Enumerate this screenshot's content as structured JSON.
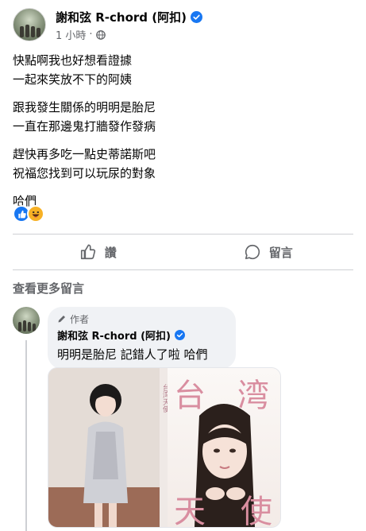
{
  "post": {
    "author": "謝和弦 R-chord (阿扣)",
    "time": "1 小時",
    "dot": "·",
    "paragraphs": [
      [
        "快點啊我也好想看證據",
        "一起來笑放不下的阿姨"
      ],
      [
        "跟我發生關係的明明是胎尼",
        "一直在那邊鬼打牆發作發病"
      ],
      [
        "趕快再多吃一點史蒂諾斯吧",
        "祝福您找到可以玩尿的對象"
      ],
      [
        "哈們"
      ]
    ]
  },
  "actions": {
    "like_label": "讚",
    "comment_label": "留言"
  },
  "comments_section": {
    "more_label": "查看更多留言"
  },
  "comment": {
    "author_tag": "作者",
    "author": "謝和弦 R-chord (阿扣)",
    "text": "明明是胎尼 記錯人了啦 哈們",
    "image_text": {
      "top_right_1": "台",
      "top_right_2": "湾",
      "bottom_right_1": "天",
      "bottom_right_2": "使",
      "vertical_small": "台湾天使"
    }
  },
  "icons": {
    "verified": "verified-badge-icon",
    "globe": "globe-icon",
    "like": "like-reaction-icon",
    "haha": "haha-reaction-icon",
    "thumb": "thumb-up-icon",
    "comment": "comment-bubble-icon",
    "pencil": "pencil-icon"
  },
  "colors": {
    "brand_blue": "#1877f2",
    "secondary_text": "#65676b",
    "bubble_bg": "#f0f2f5"
  }
}
